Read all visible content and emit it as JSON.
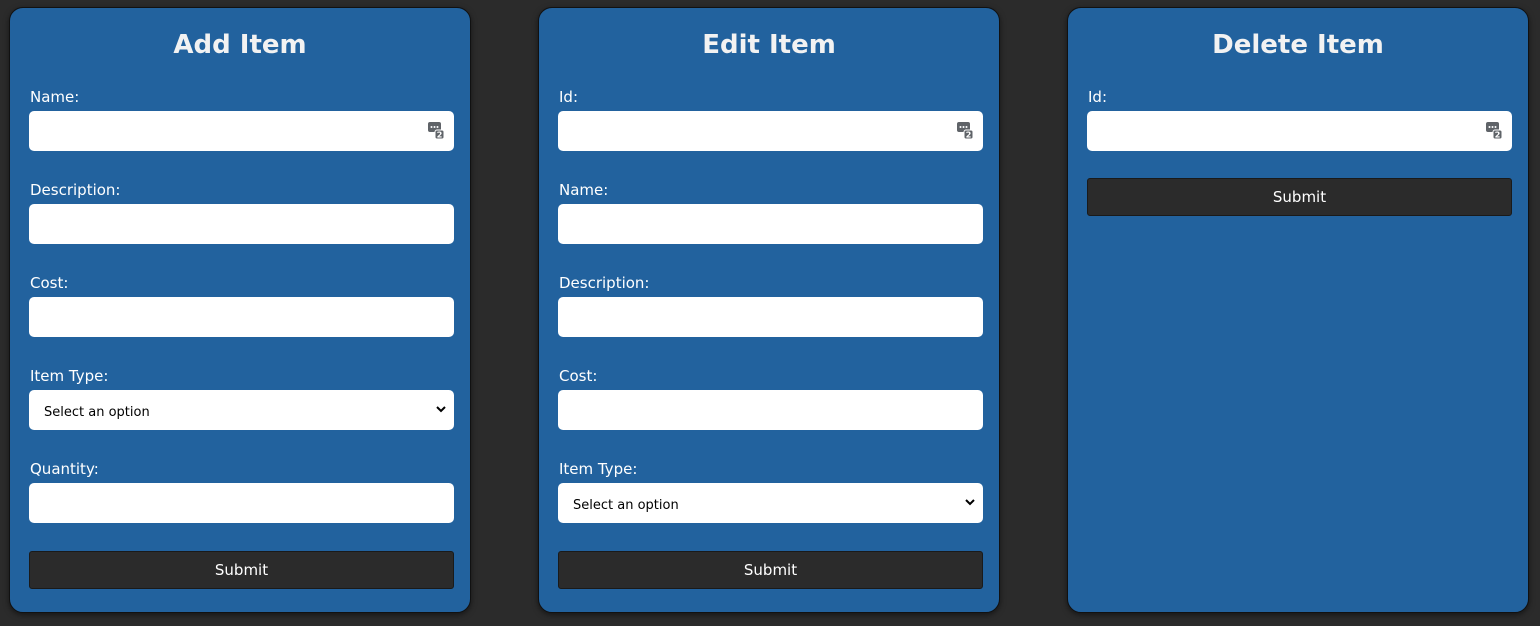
{
  "add_item": {
    "title": "Add Item",
    "fields": {
      "name": {
        "label": "Name:",
        "value": ""
      },
      "description": {
        "label": "Description:",
        "value": ""
      },
      "cost": {
        "label": "Cost:",
        "value": ""
      },
      "item_type": {
        "label": "Item Type:",
        "selected": "Select an option"
      },
      "quantity": {
        "label": "Quantity:",
        "value": ""
      }
    },
    "submit_label": "Submit"
  },
  "edit_item": {
    "title": "Edit Item",
    "fields": {
      "id": {
        "label": "Id:",
        "value": ""
      },
      "name": {
        "label": "Name:",
        "value": ""
      },
      "description": {
        "label": "Description:",
        "value": ""
      },
      "cost": {
        "label": "Cost:",
        "value": ""
      },
      "item_type": {
        "label": "Item Type:",
        "selected": "Select an option"
      }
    },
    "submit_label": "Submit"
  },
  "delete_item": {
    "title": "Delete Item",
    "fields": {
      "id": {
        "label": "Id:",
        "value": ""
      }
    },
    "submit_label": "Submit"
  },
  "colors": {
    "page_background": "#2b2b2b",
    "card_background": "#22629e",
    "button_background": "#2b2b2b",
    "input_background": "#ffffff"
  },
  "icons": {
    "password_manager": "password-manager-icon",
    "dropdown": "chevron-down-icon"
  }
}
